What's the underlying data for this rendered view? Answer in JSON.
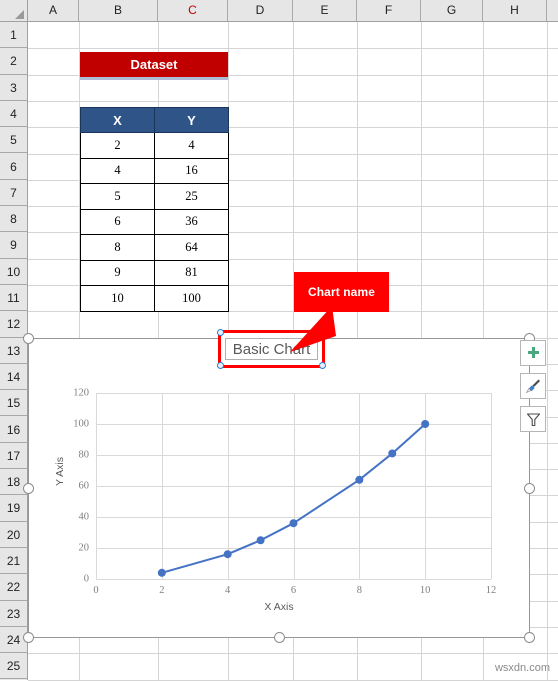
{
  "spreadsheet": {
    "columns": [
      "A",
      "B",
      "C",
      "D",
      "E",
      "F",
      "G",
      "H"
    ],
    "selected_column": "C",
    "rows": [
      "1",
      "2",
      "3",
      "4",
      "5",
      "6",
      "7",
      "8",
      "9",
      "10",
      "11",
      "12",
      "13",
      "14",
      "15",
      "16",
      "17",
      "18",
      "19",
      "20",
      "21",
      "22",
      "23",
      "24",
      "25"
    ],
    "banner": {
      "label": "Dataset",
      "fill": "#C00000",
      "text_color": "#FFFFFF"
    }
  },
  "table": {
    "headers": [
      "X",
      "Y"
    ],
    "header_fill": "#2E5488",
    "rows": [
      [
        "2",
        "4"
      ],
      [
        "4",
        "16"
      ],
      [
        "5",
        "25"
      ],
      [
        "6",
        "36"
      ],
      [
        "8",
        "64"
      ],
      [
        "9",
        "81"
      ],
      [
        "10",
        "100"
      ]
    ]
  },
  "callout": {
    "label": "Chart name",
    "fill": "#FF0000",
    "text_color": "#FFFFFF"
  },
  "chart": {
    "title": "Basic Chart",
    "title_edit_border": "#FF0000",
    "side_buttons": [
      {
        "name": "chart-elements",
        "icon": "plus-icon"
      },
      {
        "name": "chart-styles",
        "icon": "paintbrush-icon"
      },
      {
        "name": "chart-filters",
        "icon": "funnel-icon"
      }
    ]
  },
  "watermark": {
    "text": "wsxdn.com"
  },
  "chart_data": {
    "type": "line",
    "title": "Basic Chart",
    "xlabel": "X Axis",
    "ylabel": "Y Axis",
    "x": [
      2,
      4,
      5,
      6,
      8,
      9,
      10
    ],
    "series": [
      {
        "name": "Y",
        "values": [
          4,
          16,
          25,
          36,
          64,
          81,
          100
        ],
        "color": "#4472C4",
        "marker": "circle"
      }
    ],
    "xlim": [
      0,
      12
    ],
    "ylim": [
      0,
      120
    ],
    "xticks": [
      0,
      2,
      4,
      6,
      8,
      10,
      12
    ],
    "yticks": [
      0,
      20,
      40,
      60,
      80,
      100,
      120
    ],
    "grid": true,
    "legend": false
  }
}
